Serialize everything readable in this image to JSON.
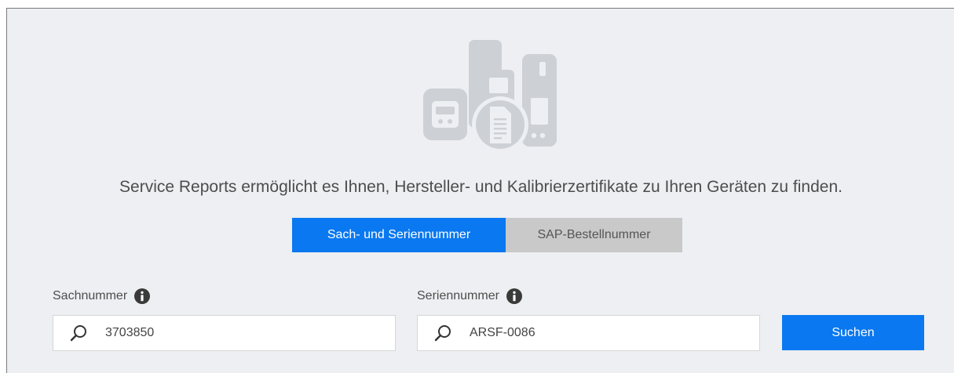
{
  "intro": {
    "text": "Service Reports ermöglicht es Ihnen, Hersteller- und Kalibrierzertifikate zu Ihren Geräten zu finden."
  },
  "tabs": [
    {
      "label": "Sach- und Seriennummer",
      "active": true
    },
    {
      "label": "SAP-Bestellnummer",
      "active": false
    }
  ],
  "fields": {
    "part_number": {
      "label": "Sachnummer",
      "value": "3703850",
      "icon": "search-icon"
    },
    "serial_number": {
      "label": "Seriennummer",
      "value": "ARSF-0086",
      "icon": "search-icon"
    }
  },
  "search_button": {
    "label": "Suchen"
  },
  "colors": {
    "accent": "#0a78f0",
    "tab_inactive": "#c9c9c9",
    "panel_background": "#edeff2",
    "illustration": "#cdd0d5"
  },
  "icons": {
    "hero": "devices-certificate-icon",
    "info": "info-icon",
    "search": "search-icon"
  }
}
